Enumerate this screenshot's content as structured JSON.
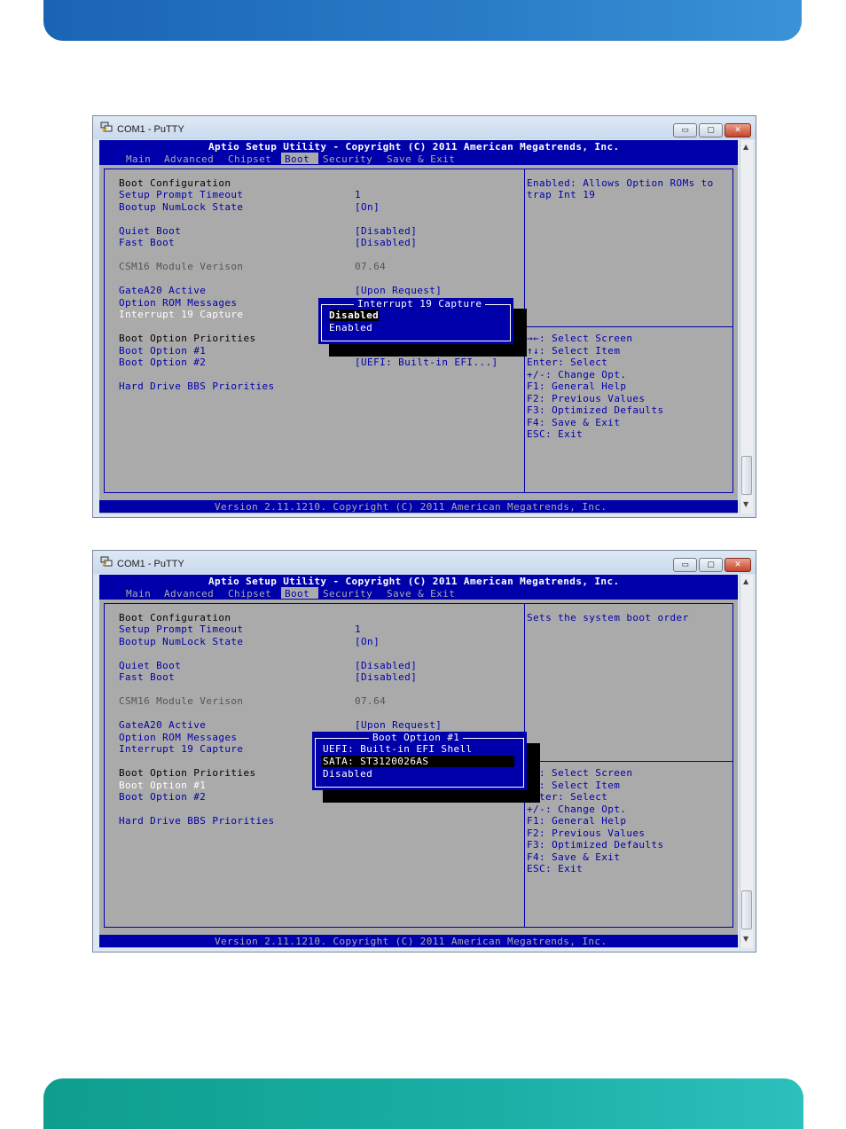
{
  "window_title": "COM1 - PuTTY",
  "window_buttons": {
    "minimize": "▭",
    "maximize": "▢",
    "close": "✕"
  },
  "header": "Aptio Setup Utility - Copyright (C) 2011 American Megatrends, Inc.",
  "tabs": [
    "Main",
    "Advanced",
    "Chipset",
    "Boot",
    "Security",
    "Save & Exit"
  ],
  "active_tab": "Boot",
  "footer": "Version 2.11.1210. Copyright (C) 2011 American Megatrends, Inc.",
  "settings": {
    "boot_configuration": "Boot Configuration",
    "setup_prompt_timeout": {
      "label": "Setup Prompt Timeout",
      "value": "1"
    },
    "bootup_numlock": {
      "label": "Bootup NumLock State",
      "value": "[On]"
    },
    "quiet_boot": {
      "label": "Quiet Boot",
      "value": "[Disabled]"
    },
    "fast_boot": {
      "label": "Fast Boot",
      "value": "[Disabled]"
    },
    "csm16": {
      "label": "CSM16 Module Verison",
      "value": "07.64"
    },
    "gatea20": {
      "label": "GateA20 Active",
      "value": "[Upon Request]"
    },
    "option_rom": {
      "label": "Option ROM Messages"
    },
    "interrupt19": {
      "label": "Interrupt 19 Capture"
    },
    "boot_option_priorities": "Boot Option Priorities",
    "boot_option_1": {
      "label": "Boot Option #1"
    },
    "boot_option_2": {
      "label": "Boot Option #2",
      "value": "[UEFI: Built-in EFI...]"
    },
    "hdd_bbs": "Hard Drive BBS Priorities"
  },
  "help_keys": [
    "→←: Select Screen",
    "↑↓: Select Item",
    "Enter: Select",
    "+/-: Change Opt.",
    "F1: General Help",
    "F2: Previous Values",
    "F3: Optimized Defaults",
    "F4: Save & Exit",
    "ESC: Exit"
  ],
  "help_keys_cut": [
    ": Select Screen",
    ": Select Item",
    "ter: Select"
  ],
  "screen1": {
    "help_text_1": "Enabled: Allows Option ROMs to",
    "help_text_2": "trap Int 19",
    "popup": {
      "title": "Interrupt 19 Capture",
      "options": [
        "Disabled",
        "Enabled"
      ],
      "selected": "Disabled"
    }
  },
  "screen2": {
    "help_text_1": "Sets the system boot order",
    "popup": {
      "title": "Boot Option #1",
      "options": [
        "UEFI: Built-in EFI Shell",
        "SATA: ST3120026AS",
        "Disabled"
      ],
      "selected": "SATA: ST3120026AS"
    }
  }
}
